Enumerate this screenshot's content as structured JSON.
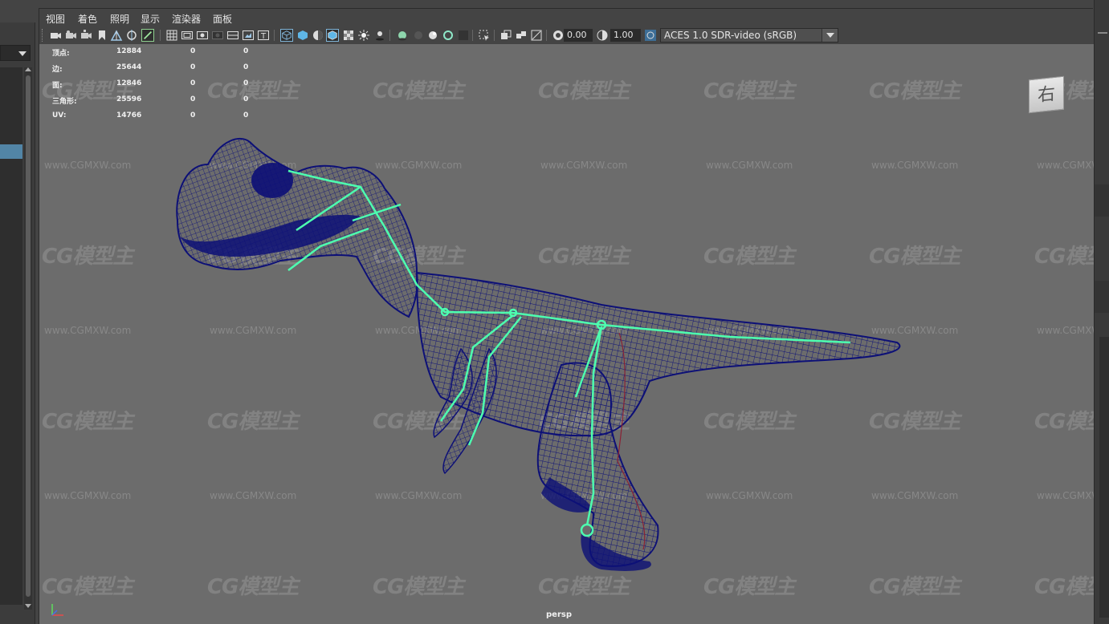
{
  "menu": {
    "items": [
      "视图",
      "着色",
      "照明",
      "显示",
      "渲染器",
      "面板"
    ]
  },
  "toolbar": {
    "exposure_value": "0.00",
    "gamma_value": "1.00",
    "color_space": "ACES 1.0 SDR-video (sRGB)"
  },
  "hud": {
    "rows": [
      {
        "label": "顶点:",
        "total": "12884",
        "sel1": "0",
        "sel2": "0"
      },
      {
        "label": "边:",
        "total": "25644",
        "sel1": "0",
        "sel2": "0"
      },
      {
        "label": "面:",
        "total": "12846",
        "sel1": "0",
        "sel2": "0"
      },
      {
        "label": "三角形:",
        "total": "25596",
        "sel1": "0",
        "sel2": "0"
      },
      {
        "label": "UV:",
        "total": "14766",
        "sel1": "0",
        "sel2": "0"
      }
    ]
  },
  "viewport": {
    "camera_label": "persp",
    "view_cube_label": "右"
  },
  "watermark": {
    "logo_text": "CG模型主",
    "url_text": "www.CGMXW.com"
  },
  "colors": {
    "viewport_bg": "#6c6c6c",
    "wireframe": "#0d1077",
    "joints": "#4dffb0",
    "selection": "#5285a6"
  },
  "icons": [
    "camera-icon",
    "bookmark-icon",
    "grid-icon",
    "wireframe-icon",
    "smooth-shade-icon",
    "xray-icon",
    "lighting-icon",
    "exposure-icon",
    "gamma-icon",
    "colorspace-icon"
  ]
}
